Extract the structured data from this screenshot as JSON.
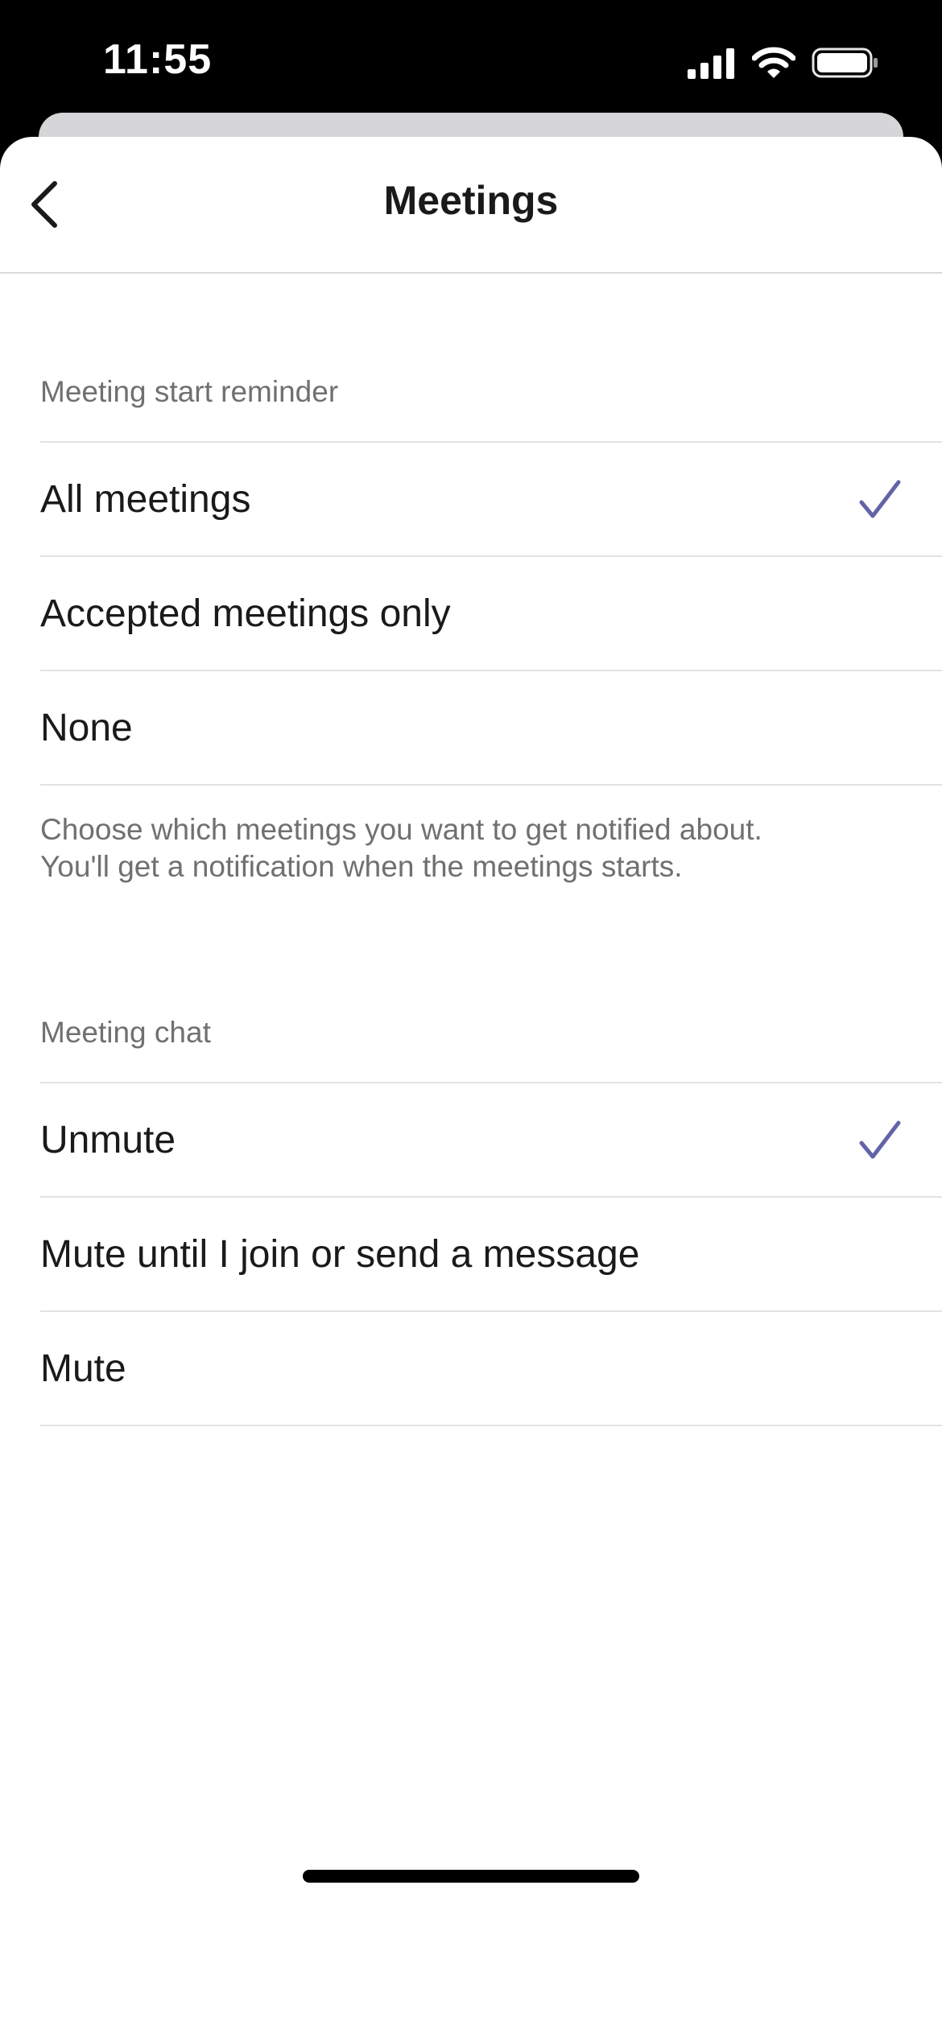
{
  "status_bar": {
    "time": "11:55",
    "icons": [
      "signal-icon",
      "wifi-icon",
      "battery-icon"
    ]
  },
  "nav": {
    "title": "Meetings",
    "back_icon": "chevron-left-icon"
  },
  "reminder_section": {
    "header": "Meeting start reminder",
    "options": [
      {
        "label": "All meetings",
        "selected": true
      },
      {
        "label": "Accepted meetings only",
        "selected": false
      },
      {
        "label": "None",
        "selected": false
      }
    ],
    "footnote_line1": "Choose which meetings you want to get notified about.",
    "footnote_line2": "You'll get a notification when the meetings starts."
  },
  "chat_section": {
    "header": "Meeting chat",
    "options": [
      {
        "label": "Unmute",
        "selected": true
      },
      {
        "label": "Mute until I join or send a message",
        "selected": false
      },
      {
        "label": "Mute",
        "selected": false
      }
    ]
  },
  "colors": {
    "accent": "#6264A7",
    "secondary_text": "#707070",
    "divider": "#E3E3E3"
  }
}
